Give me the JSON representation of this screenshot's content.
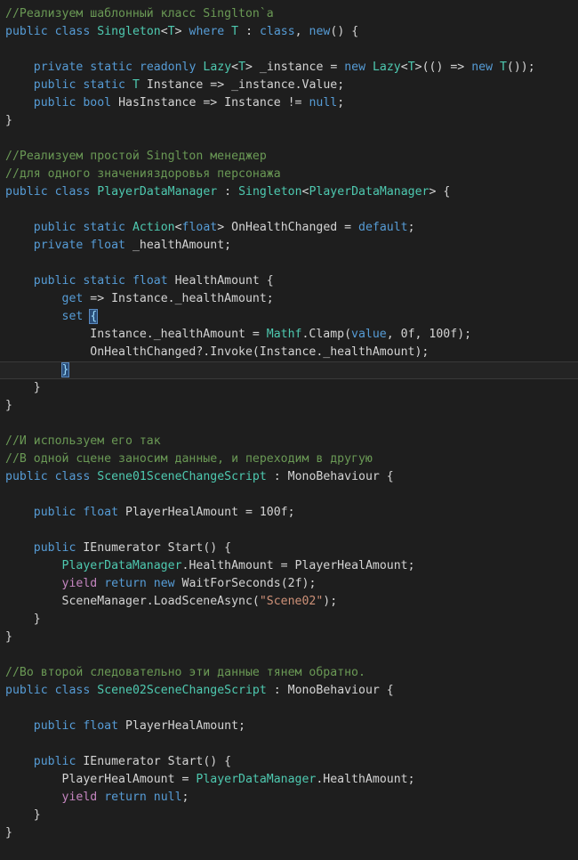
{
  "editor": {
    "language": "csharp",
    "background_color": "#1e1e1e",
    "foreground_color": "#d4d4d4",
    "current_line_index": 21,
    "theme_colors": {
      "keyword": "#569cd6",
      "control_keyword": "#c586c0",
      "type": "#4ec9b0",
      "comment": "#6a9955",
      "string": "#ce9178",
      "plain": "#d4d4d4",
      "current_line_background": "#242424",
      "current_line_border": "#3a3a3a",
      "brace_match_background": "#2a4d78",
      "brace_match_foreground": "#9cdcfe"
    }
  },
  "code": {
    "lines": [
      {
        "i": 0,
        "tokens": [
          {
            "t": "//Реализуем шаблонный класс Singlton`a",
            "c": "cmt"
          }
        ]
      },
      {
        "i": 1,
        "tokens": [
          {
            "t": "public",
            "c": "kw"
          },
          {
            "t": " ",
            "c": "pln"
          },
          {
            "t": "class",
            "c": "kw"
          },
          {
            "t": " ",
            "c": "pln"
          },
          {
            "t": "Singleton",
            "c": "typ"
          },
          {
            "t": "<",
            "c": "pln"
          },
          {
            "t": "T",
            "c": "typ"
          },
          {
            "t": "> ",
            "c": "pln"
          },
          {
            "t": "where",
            "c": "kw"
          },
          {
            "t": " ",
            "c": "pln"
          },
          {
            "t": "T",
            "c": "typ"
          },
          {
            "t": " : ",
            "c": "pln"
          },
          {
            "t": "class",
            "c": "kw"
          },
          {
            "t": ", ",
            "c": "pln"
          },
          {
            "t": "new",
            "c": "kw"
          },
          {
            "t": "() {",
            "c": "pln"
          }
        ]
      },
      {
        "i": 2,
        "tokens": []
      },
      {
        "i": 3,
        "tokens": [
          {
            "t": "    ",
            "c": "pln"
          },
          {
            "t": "private",
            "c": "kw"
          },
          {
            "t": " ",
            "c": "pln"
          },
          {
            "t": "static",
            "c": "kw"
          },
          {
            "t": " ",
            "c": "pln"
          },
          {
            "t": "readonly",
            "c": "kw"
          },
          {
            "t": " ",
            "c": "pln"
          },
          {
            "t": "Lazy",
            "c": "typ"
          },
          {
            "t": "<",
            "c": "pln"
          },
          {
            "t": "T",
            "c": "typ"
          },
          {
            "t": "> _instance = ",
            "c": "pln"
          },
          {
            "t": "new",
            "c": "kw"
          },
          {
            "t": " ",
            "c": "pln"
          },
          {
            "t": "Lazy",
            "c": "typ"
          },
          {
            "t": "<",
            "c": "pln"
          },
          {
            "t": "T",
            "c": "typ"
          },
          {
            "t": ">(() => ",
            "c": "pln"
          },
          {
            "t": "new",
            "c": "kw"
          },
          {
            "t": " ",
            "c": "pln"
          },
          {
            "t": "T",
            "c": "typ"
          },
          {
            "t": "());",
            "c": "pln"
          }
        ]
      },
      {
        "i": 4,
        "tokens": [
          {
            "t": "    ",
            "c": "pln"
          },
          {
            "t": "public",
            "c": "kw"
          },
          {
            "t": " ",
            "c": "pln"
          },
          {
            "t": "static",
            "c": "kw"
          },
          {
            "t": " ",
            "c": "pln"
          },
          {
            "t": "T",
            "c": "typ"
          },
          {
            "t": " Instance => _instance.Value;",
            "c": "pln"
          }
        ]
      },
      {
        "i": 5,
        "tokens": [
          {
            "t": "    ",
            "c": "pln"
          },
          {
            "t": "public",
            "c": "kw"
          },
          {
            "t": " ",
            "c": "pln"
          },
          {
            "t": "bool",
            "c": "kw"
          },
          {
            "t": " HasInstance => Instance != ",
            "c": "pln"
          },
          {
            "t": "null",
            "c": "kw"
          },
          {
            "t": ";",
            "c": "pln"
          }
        ]
      },
      {
        "i": 6,
        "tokens": [
          {
            "t": "}",
            "c": "pln"
          }
        ]
      },
      {
        "i": 7,
        "tokens": []
      },
      {
        "i": 8,
        "tokens": [
          {
            "t": "//Реализуем простой Singlton менеджер",
            "c": "cmt"
          }
        ]
      },
      {
        "i": 9,
        "tokens": [
          {
            "t": "//для одного значенияздоровья персонажа",
            "c": "cmt"
          }
        ]
      },
      {
        "i": 10,
        "tokens": [
          {
            "t": "public",
            "c": "kw"
          },
          {
            "t": " ",
            "c": "pln"
          },
          {
            "t": "class",
            "c": "kw"
          },
          {
            "t": " ",
            "c": "pln"
          },
          {
            "t": "PlayerDataManager",
            "c": "typ"
          },
          {
            "t": " : ",
            "c": "pln"
          },
          {
            "t": "Singleton",
            "c": "typ"
          },
          {
            "t": "<",
            "c": "pln"
          },
          {
            "t": "PlayerDataManager",
            "c": "typ"
          },
          {
            "t": "> {",
            "c": "pln"
          }
        ]
      },
      {
        "i": 11,
        "tokens": []
      },
      {
        "i": 12,
        "tokens": [
          {
            "t": "    ",
            "c": "pln"
          },
          {
            "t": "public",
            "c": "kw"
          },
          {
            "t": " ",
            "c": "pln"
          },
          {
            "t": "static",
            "c": "kw"
          },
          {
            "t": " ",
            "c": "pln"
          },
          {
            "t": "Action",
            "c": "typ"
          },
          {
            "t": "<",
            "c": "pln"
          },
          {
            "t": "float",
            "c": "kw"
          },
          {
            "t": "> OnHealthChanged = ",
            "c": "pln"
          },
          {
            "t": "default",
            "c": "kw"
          },
          {
            "t": ";",
            "c": "pln"
          }
        ]
      },
      {
        "i": 13,
        "tokens": [
          {
            "t": "    ",
            "c": "pln"
          },
          {
            "t": "private",
            "c": "kw"
          },
          {
            "t": " ",
            "c": "pln"
          },
          {
            "t": "float",
            "c": "kw"
          },
          {
            "t": " _healthAmount;",
            "c": "pln"
          }
        ]
      },
      {
        "i": 14,
        "tokens": []
      },
      {
        "i": 15,
        "tokens": [
          {
            "t": "    ",
            "c": "pln"
          },
          {
            "t": "public",
            "c": "kw"
          },
          {
            "t": " ",
            "c": "pln"
          },
          {
            "t": "static",
            "c": "kw"
          },
          {
            "t": " ",
            "c": "pln"
          },
          {
            "t": "float",
            "c": "kw"
          },
          {
            "t": " HealthAmount {",
            "c": "pln"
          }
        ]
      },
      {
        "i": 16,
        "tokens": [
          {
            "t": "        ",
            "c": "pln"
          },
          {
            "t": "get",
            "c": "kw"
          },
          {
            "t": " => Instance._healthAmount;",
            "c": "pln"
          }
        ]
      },
      {
        "i": 17,
        "tokens": [
          {
            "t": "        ",
            "c": "pln"
          },
          {
            "t": "set",
            "c": "kw"
          },
          {
            "t": " ",
            "c": "pln"
          },
          {
            "t": "{",
            "c": "brace-match"
          }
        ]
      },
      {
        "i": 18,
        "tokens": [
          {
            "t": "            Instance._healthAmount = ",
            "c": "pln"
          },
          {
            "t": "Mathf",
            "c": "typ"
          },
          {
            "t": ".Clamp(",
            "c": "pln"
          },
          {
            "t": "value",
            "c": "kw"
          },
          {
            "t": ", ",
            "c": "pln"
          },
          {
            "t": "0f",
            "c": "num"
          },
          {
            "t": ", ",
            "c": "pln"
          },
          {
            "t": "100f",
            "c": "num"
          },
          {
            "t": ");",
            "c": "pln"
          }
        ]
      },
      {
        "i": 19,
        "tokens": [
          {
            "t": "            OnHealthChanged?.Invoke(Instance._healthAmount);",
            "c": "pln"
          }
        ]
      },
      {
        "i": 20,
        "tokens": [
          {
            "t": "        ",
            "c": "pln"
          },
          {
            "t": "}",
            "c": "brace-match"
          }
        ],
        "current": true
      },
      {
        "i": 21,
        "tokens": [
          {
            "t": "    }",
            "c": "pln"
          }
        ]
      },
      {
        "i": 22,
        "tokens": [
          {
            "t": "}",
            "c": "pln"
          }
        ]
      },
      {
        "i": 23,
        "tokens": []
      },
      {
        "i": 24,
        "tokens": [
          {
            "t": "//И используем его так",
            "c": "cmt"
          }
        ]
      },
      {
        "i": 25,
        "tokens": [
          {
            "t": "//В одной сцене заносим данные, и переходим в другую",
            "c": "cmt"
          }
        ]
      },
      {
        "i": 26,
        "tokens": [
          {
            "t": "public",
            "c": "kw"
          },
          {
            "t": " ",
            "c": "pln"
          },
          {
            "t": "class",
            "c": "kw"
          },
          {
            "t": " ",
            "c": "pln"
          },
          {
            "t": "Scene01SceneChangeScript",
            "c": "typ"
          },
          {
            "t": " : ",
            "c": "pln"
          },
          {
            "t": "MonoBehaviour",
            "c": "pln"
          },
          {
            "t": " {",
            "c": "pln"
          }
        ]
      },
      {
        "i": 27,
        "tokens": []
      },
      {
        "i": 28,
        "tokens": [
          {
            "t": "    ",
            "c": "pln"
          },
          {
            "t": "public",
            "c": "kw"
          },
          {
            "t": " ",
            "c": "pln"
          },
          {
            "t": "float",
            "c": "kw"
          },
          {
            "t": " PlayerHealAmount = ",
            "c": "pln"
          },
          {
            "t": "100f",
            "c": "num"
          },
          {
            "t": ";",
            "c": "pln"
          }
        ]
      },
      {
        "i": 29,
        "tokens": []
      },
      {
        "i": 30,
        "tokens": [
          {
            "t": "    ",
            "c": "pln"
          },
          {
            "t": "public",
            "c": "kw"
          },
          {
            "t": " ",
            "c": "pln"
          },
          {
            "t": "IEnumerator",
            "c": "pln"
          },
          {
            "t": " Start() {",
            "c": "pln"
          }
        ]
      },
      {
        "i": 31,
        "tokens": [
          {
            "t": "        ",
            "c": "pln"
          },
          {
            "t": "PlayerDataManager",
            "c": "typ"
          },
          {
            "t": ".HealthAmount = PlayerHealAmount;",
            "c": "pln"
          }
        ]
      },
      {
        "i": 32,
        "tokens": [
          {
            "t": "        ",
            "c": "pln"
          },
          {
            "t": "yield",
            "c": "ctl"
          },
          {
            "t": " ",
            "c": "pln"
          },
          {
            "t": "return",
            "c": "kw"
          },
          {
            "t": " ",
            "c": "pln"
          },
          {
            "t": "new",
            "c": "kw"
          },
          {
            "t": " WaitForSeconds(",
            "c": "pln"
          },
          {
            "t": "2f",
            "c": "num"
          },
          {
            "t": ");",
            "c": "pln"
          }
        ]
      },
      {
        "i": 33,
        "tokens": [
          {
            "t": "        SceneManager.LoadSceneAsync(",
            "c": "pln"
          },
          {
            "t": "\"Scene02\"",
            "c": "str"
          },
          {
            "t": ");",
            "c": "pln"
          }
        ]
      },
      {
        "i": 34,
        "tokens": [
          {
            "t": "    }",
            "c": "pln"
          }
        ]
      },
      {
        "i": 35,
        "tokens": [
          {
            "t": "}",
            "c": "pln"
          }
        ]
      },
      {
        "i": 36,
        "tokens": []
      },
      {
        "i": 37,
        "tokens": [
          {
            "t": "//Во второй следовательно эти данные тянем обратно.",
            "c": "cmt"
          }
        ]
      },
      {
        "i": 38,
        "tokens": [
          {
            "t": "public",
            "c": "kw"
          },
          {
            "t": " ",
            "c": "pln"
          },
          {
            "t": "class",
            "c": "kw"
          },
          {
            "t": " ",
            "c": "pln"
          },
          {
            "t": "Scene02SceneChangeScript",
            "c": "typ"
          },
          {
            "t": " : ",
            "c": "pln"
          },
          {
            "t": "MonoBehaviour",
            "c": "pln"
          },
          {
            "t": " {",
            "c": "pln"
          }
        ]
      },
      {
        "i": 39,
        "tokens": []
      },
      {
        "i": 40,
        "tokens": [
          {
            "t": "    ",
            "c": "pln"
          },
          {
            "t": "public",
            "c": "kw"
          },
          {
            "t": " ",
            "c": "pln"
          },
          {
            "t": "float",
            "c": "kw"
          },
          {
            "t": " PlayerHealAmount;",
            "c": "pln"
          }
        ]
      },
      {
        "i": 41,
        "tokens": []
      },
      {
        "i": 42,
        "tokens": [
          {
            "t": "    ",
            "c": "pln"
          },
          {
            "t": "public",
            "c": "kw"
          },
          {
            "t": " ",
            "c": "pln"
          },
          {
            "t": "IEnumerator",
            "c": "pln"
          },
          {
            "t": " Start() {",
            "c": "pln"
          }
        ]
      },
      {
        "i": 43,
        "tokens": [
          {
            "t": "        PlayerHealAmount = ",
            "c": "pln"
          },
          {
            "t": "PlayerDataManager",
            "c": "typ"
          },
          {
            "t": ".HealthAmount;",
            "c": "pln"
          }
        ]
      },
      {
        "i": 44,
        "tokens": [
          {
            "t": "        ",
            "c": "pln"
          },
          {
            "t": "yield",
            "c": "ctl"
          },
          {
            "t": " ",
            "c": "pln"
          },
          {
            "t": "return",
            "c": "kw"
          },
          {
            "t": " ",
            "c": "pln"
          },
          {
            "t": "null",
            "c": "kw"
          },
          {
            "t": ";",
            "c": "pln"
          }
        ]
      },
      {
        "i": 45,
        "tokens": [
          {
            "t": "    }",
            "c": "pln"
          }
        ]
      },
      {
        "i": 46,
        "tokens": [
          {
            "t": "}",
            "c": "pln"
          }
        ]
      },
      {
        "i": 47,
        "tokens": []
      }
    ]
  }
}
